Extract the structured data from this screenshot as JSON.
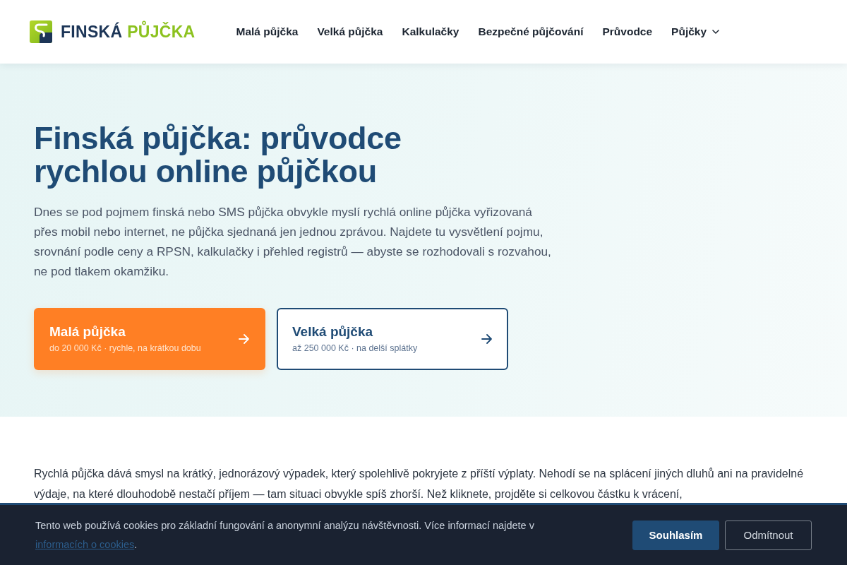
{
  "header": {
    "logo": {
      "word_1": "FINSKÁ",
      "word_2": "PŮJČKA"
    },
    "nav": [
      {
        "label": "Malá půjčka",
        "kind": "link"
      },
      {
        "label": "Velká půjčka",
        "kind": "link"
      },
      {
        "label": "Kalkulačky",
        "kind": "link"
      },
      {
        "label": "Bezpečné půjčování",
        "kind": "link"
      },
      {
        "label": "Průvodce",
        "kind": "link"
      },
      {
        "label": "Půjčky",
        "kind": "dropdown"
      }
    ]
  },
  "hero": {
    "title": "Finská půjčka: průvodce rychlou online půjčkou",
    "intro": "Dnes se pod pojmem finská nebo SMS půjčka obvykle myslí rychlá online půjčka vyřizovaná přes mobil nebo internet, ne půjčka sjednaná jen jednou zprávou. Najdete tu vysvětlení pojmu, srovnání podle ceny a RPSN, kalkulačky i přehled registrů — abyste se rozhodovali s rozvahou, ne pod tlakem okamžiku.",
    "cards": [
      {
        "title": "Malá půjčka",
        "subtitle": "do 20 000 Kč · rychle, na krátkou dobu",
        "kind": "primary"
      },
      {
        "title": "Velká půjčka",
        "subtitle": "až 250 000 Kč · na delší splátky",
        "kind": "outline"
      }
    ]
  },
  "content": {
    "paragraph": "Rychlá půjčka dává smysl na krátký, jednorázový výpadek, který spolehlivě pokryjete z příští výplaty. Nehodí se na splácení jiných dluhů ani na pravidelné výdaje, na které dlouhodobě nestačí příjem — tam situaci obvykle spíš zhorší. Než kliknete, projděte si celkovou částku k vrácení,"
  },
  "cookie_banner": {
    "text": "Tento web používá cookies pro základní fungování a anonymní analýzu návštěvnosti. Více informací najdete v",
    "link": "informacích o cookies",
    "text_end": ".",
    "buttons": [
      {
        "label": "Souhlasím",
        "kind": "primary"
      },
      {
        "label": "Odmítnout",
        "kind": "secondary"
      }
    ]
  }
}
